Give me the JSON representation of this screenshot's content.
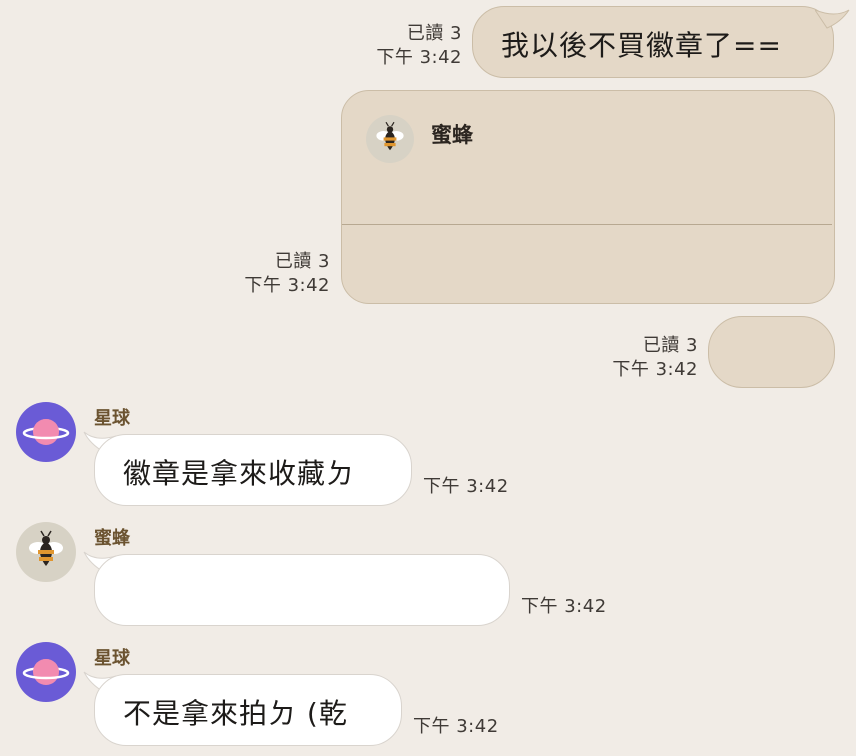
{
  "messages": {
    "m1": {
      "read": "已讀 3",
      "time": "下午 3:42",
      "text": "我以後不買徽章了=="
    },
    "m2": {
      "read": "已讀 3",
      "time": "下午 3:42",
      "card_name": "蜜蜂"
    },
    "m3": {
      "read": "已讀 3",
      "time": "下午 3:42"
    },
    "m4": {
      "sender": "星球",
      "time": "下午 3:42",
      "text": "徽章是拿來收藏ㄉ"
    },
    "m5": {
      "sender": "蜜蜂",
      "time": "下午 3:42",
      "text": ""
    },
    "m6": {
      "sender": "星球",
      "time": "下午 3:42",
      "text": "不是拿來拍ㄉ (乾"
    }
  },
  "colors": {
    "background": "#f1ece6",
    "outgoing_bubble": "#e4d8c7",
    "incoming_bubble": "#ffffff",
    "sender_name": "#6b5330",
    "planet_avatar_bg": "#6a5bd6",
    "bee_avatar_bg": "#d7d2c5"
  },
  "icons": {
    "planet_avatar": "planet-icon",
    "bee_avatar": "bee-icon"
  }
}
